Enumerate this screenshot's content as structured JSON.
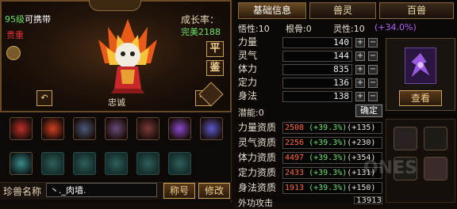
{
  "pet": {
    "level": "95级",
    "name": "可携带",
    "rarity": "贵重",
    "growth_label": "成长率：",
    "growth_value": "完美2188",
    "title": "忠诚",
    "btn_ping": "平",
    "btn_jian": "鉴",
    "rot_left_glyph": "↶",
    "rot_right_glyph": "↷",
    "name_label": "珍兽名称",
    "name_value": "丶._肉墙.",
    "btn_title": "称号",
    "btn_modify": "修改",
    "skills_row1": [
      {
        "icon": "fire-skill-icon",
        "color": "#c0302a"
      },
      {
        "icon": "bow-skill-icon",
        "color": "#d04020"
      },
      {
        "icon": "skull-skill-icon",
        "color": "#4a5a7a"
      },
      {
        "icon": "demon-skill-icon",
        "color": "#6a4a7a"
      },
      {
        "icon": "shadow-skill-icon",
        "color": "#7a3a3a"
      },
      {
        "icon": "lightning-skill-icon",
        "color": "#8a4ad0"
      },
      {
        "icon": "claw-skill-icon",
        "color": "#5a5ad0"
      }
    ],
    "skills_row2": [
      {
        "icon": "tiger-skill-icon",
        "color": "#3a8a8a",
        "empty": false
      },
      {
        "icon": "empty-slot-icon",
        "empty": true
      },
      {
        "icon": "empty-slot-icon",
        "empty": true
      },
      {
        "icon": "empty-slot-icon",
        "empty": true
      },
      {
        "icon": "empty-slot-icon",
        "empty": true
      },
      {
        "icon": "empty-slot-icon",
        "empty": true
      }
    ]
  },
  "tabs": [
    "基础信息",
    "兽灵",
    "百兽"
  ],
  "affinity": {
    "wuxing": "悟性:10",
    "gengu": "根骨:0",
    "lingxing": "灵性:10",
    "lingxing_bonus": "(+34.0%)"
  },
  "attributes": [
    {
      "label": "力量",
      "value": "140"
    },
    {
      "label": "灵气",
      "value": "144"
    },
    {
      "label": "体力",
      "value": "835"
    },
    {
      "label": "定力",
      "value": "136"
    },
    {
      "label": "身法",
      "value": "138"
    }
  ],
  "plus_symbol": "+",
  "minus_symbol": "−",
  "potential": "潜能:0",
  "confirm": "确定",
  "aptitudes": [
    {
      "label": "力量资质",
      "base": "2508",
      "pct": "(+39.3%)",
      "bonus": "(+135)"
    },
    {
      "label": "灵气资质",
      "base": "2256",
      "pct": "(+39.3%)",
      "bonus": "(+230)"
    },
    {
      "label": "体力资质",
      "base": "4497",
      "pct": "(+39.3%)",
      "bonus": "(+354)"
    },
    {
      "label": "定力资质",
      "base": "2433",
      "pct": "(+39.3%)",
      "bonus": "(+131)"
    },
    {
      "label": "身法资质",
      "base": "1913",
      "pct": "(+39.3%)",
      "bonus": "(+150)"
    }
  ],
  "outer_attack": "外功攻击",
  "outer_attack_value": "13913",
  "view_button": "查看",
  "watermark": "ONES"
}
